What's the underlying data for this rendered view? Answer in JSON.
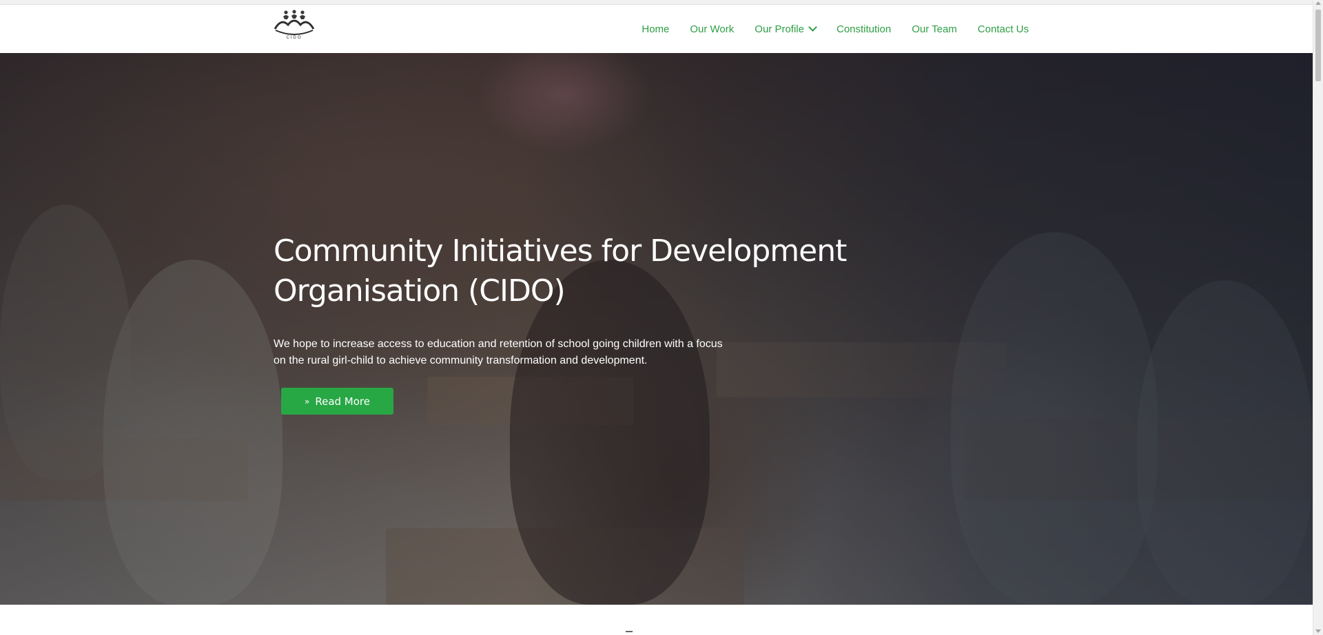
{
  "logo": {
    "alt": "CIDO",
    "text": "CIDO"
  },
  "nav": {
    "items": [
      {
        "label": "Home"
      },
      {
        "label": "Our Work"
      },
      {
        "label": "Our Profile"
      },
      {
        "label": "Constitution"
      },
      {
        "label": "Our Team"
      },
      {
        "label": "Contact Us"
      }
    ]
  },
  "hero": {
    "title": "Community Initiatives for Development Organisation (CIDO)",
    "text": "We hope to increase access to education and retention of school going children with a focus on the rural girl-child to achieve community transformation and development.",
    "button_label": "Read More",
    "button_icon": "double-chevron-down-icon"
  },
  "colors": {
    "accent": "#28a745",
    "nav_link": "#2f9e44"
  }
}
